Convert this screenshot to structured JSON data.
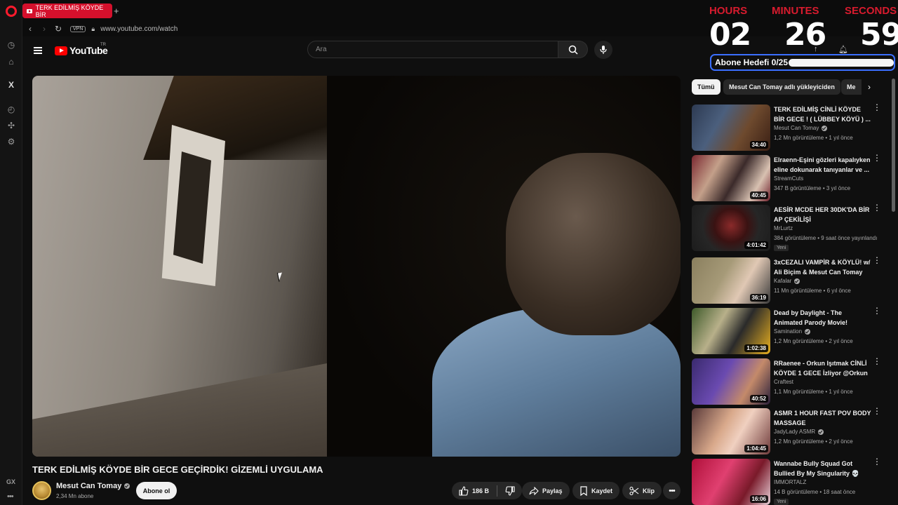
{
  "browser": {
    "tab_title": "TERK EDİLMİŞ KÖYDE BİR",
    "vpn_label": "VPN",
    "url": "www.youtube.com/watch",
    "gx_label": "GX"
  },
  "header": {
    "logo_text": "YouTube",
    "country_code": "TR",
    "search_placeholder": "Ara"
  },
  "video": {
    "title": "TERK EDİLMİŞ KÖYDE BİR GECE GEÇİRDİK! GİZEMLİ UYGULAMA",
    "channel": "Mesut Can Tomay",
    "subscribers": "2,34 Mn abone",
    "subscribe_label": "Abone ol",
    "like_count": "186 B",
    "share_label": "Paylaş",
    "save_label": "Kaydet",
    "clip_label": "Klip"
  },
  "chips": [
    "Tümü",
    "Mesut Can Tomay adlı yükleyiciden",
    "Me"
  ],
  "recommendations": [
    {
      "title": "TERK EDİLMİŞ CİNLİ KÖYDE BİR GECE ! ( LÜBBEY KÖYÜ ) ...",
      "channel": "Mesut Can Tomay",
      "verified": true,
      "meta": "1,2 Mn görüntüleme • 1 yıl önce",
      "duration": "34:40",
      "badge": ""
    },
    {
      "title": "Elraenn-Eşini gözleri kapalıyken eline dokunarak tanıyanlar ve ...",
      "channel": "StreamCuts",
      "verified": false,
      "meta": "347 B görüntüleme • 3 yıl önce",
      "duration": "40:45",
      "badge": ""
    },
    {
      "title": "AESİR MCDE HER 30DK'DA BİR AP ÇEKİLİŞİ",
      "channel": "MrLurtz",
      "verified": false,
      "meta": "384 görüntüleme • 9 saat önce yayınlandı",
      "duration": "4:01:42",
      "badge": "Yeni"
    },
    {
      "title": "3xCEZALI VAMPİR & KÖYLÜ! w/ Ali Biçim & Mesut Can Tomay",
      "channel": "Kafalar",
      "verified": true,
      "meta": "11 Mn görüntüleme • 6 yıl önce",
      "duration": "36:19",
      "badge": ""
    },
    {
      "title": "Dead by Daylight - The Animated Parody Movie!",
      "channel": "Samination",
      "verified": true,
      "meta": "1,2 Mn görüntüleme • 2 yıl önce",
      "duration": "1:02:38",
      "badge": ""
    },
    {
      "title": "RRaenee - Orkun Işıtmak CİNLİ KÖYDE 1 GECE İzliyor @Orkun ...",
      "channel": "Craftest",
      "verified": false,
      "meta": "1,1 Mn görüntüleme • 1 yıl önce",
      "duration": "40:52",
      "badge": ""
    },
    {
      "title": "ASMR 1 HOUR FAST POV BODY MASSAGE",
      "channel": "JadyLady ASMR",
      "verified": true,
      "meta": "1,2 Mn görüntüleme • 2 yıl önce",
      "duration": "1:04:45",
      "badge": ""
    },
    {
      "title": "Wannabe Bully Squad Got Bullied By My Singularity 💀",
      "channel": "IMMORTALZ",
      "verified": false,
      "meta": "14 B görüntüleme • 18 saat önce",
      "duration": "16:06",
      "badge": "Yeni"
    }
  ],
  "countdown": {
    "hours_label": "HOURS",
    "minutes_label": "MINUTES",
    "seconds_label": "SECONDS",
    "hours": "02",
    "minutes": "26",
    "seconds": "59",
    "goal_label": "Abone Hedefi 0/25",
    "goal_progress": 0
  },
  "colors": {
    "accent": "#ff0000",
    "opera_red": "#d5102c",
    "countdown_label": "#d81b2e",
    "goal_border": "#3b6fff"
  }
}
